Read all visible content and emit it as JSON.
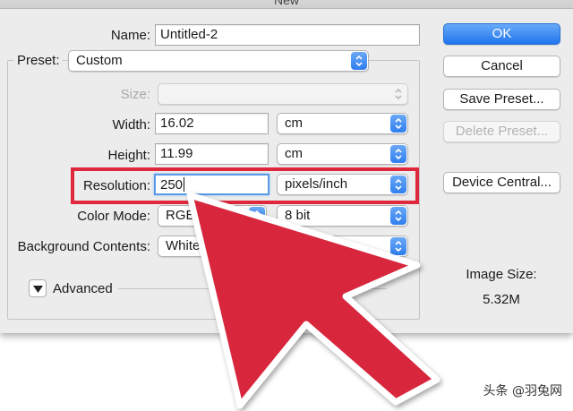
{
  "window": {
    "title": "New"
  },
  "name": {
    "label": "Name:",
    "value": "Untitled-2"
  },
  "preset": {
    "label": "Preset:",
    "value": "Custom"
  },
  "size": {
    "label": "Size:",
    "value": ""
  },
  "width": {
    "label": "Width:",
    "value": "16.02",
    "unit": "cm"
  },
  "height": {
    "label": "Height:",
    "value": "11.99",
    "unit": "cm"
  },
  "resolution": {
    "label": "Resolution:",
    "value": "250",
    "unit": "pixels/inch"
  },
  "color_mode": {
    "label": "Color Mode:",
    "value": "RGB",
    "depth": "8 bit"
  },
  "background": {
    "label": "Background Contents:",
    "value": "White"
  },
  "advanced": {
    "label": "Advanced"
  },
  "buttons": {
    "ok": "OK",
    "cancel": "Cancel",
    "save_preset": "Save Preset...",
    "delete_preset": "Delete Preset...",
    "device_central": "Device Central..."
  },
  "image_size": {
    "label": "Image Size:",
    "value": "5.32M"
  },
  "watermark": "头条 @羽兔网",
  "colors": {
    "accent": "#2f7ff0",
    "highlight": "#e0283c",
    "arrow": "#d8283e"
  }
}
